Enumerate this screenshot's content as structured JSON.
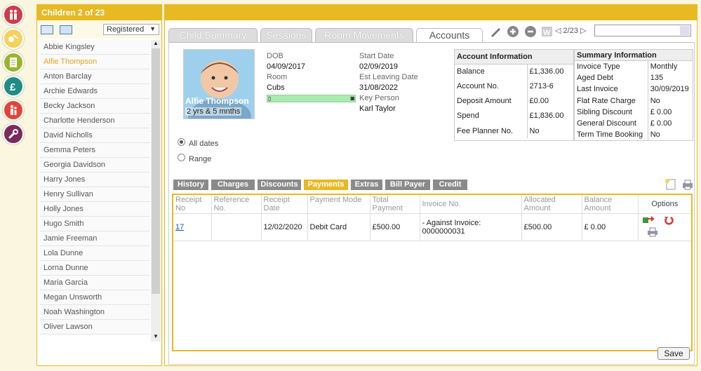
{
  "rail": [
    {
      "name": "children-nav-icon",
      "color": "#d03a4a"
    },
    {
      "name": "activities-nav-icon",
      "color": "#e8b923"
    },
    {
      "name": "registers-nav-icon",
      "color": "#9ab52d"
    },
    {
      "name": "finance-nav-icon",
      "color": "#1f8d84"
    },
    {
      "name": "staff-nav-icon",
      "color": "#e0453a"
    },
    {
      "name": "settings-nav-icon",
      "color": "#7b2a5b"
    }
  ],
  "children_panel": {
    "title": "Children 2 of 23",
    "filter_value": "Registered",
    "items": [
      "Abbie Kingsley",
      "Alfie Thompson",
      "Anton Barclay",
      "Archie Edwards",
      "Becky Jackson",
      "Charlotte Henderson",
      "David Nicholls",
      "Gemma Peters",
      "Georgia Davidson",
      "Harry Jones",
      "Henry Sullivan",
      "Holly Jones",
      "Hugo Smith",
      "Jamie Freeman",
      "Lola Dunne",
      "Lorna Dunne",
      "Maria Garcia",
      "Megan Unsworth",
      "Noah Washington",
      "Oliver Lawson"
    ],
    "active_index": 1
  },
  "tabs": [
    "Child Summary",
    "Sessions",
    "Room Movements",
    "Accounts"
  ],
  "active_tab": 3,
  "pager": "2/23",
  "search": {
    "value": "",
    "placeholder": ""
  },
  "child": {
    "name": "Alfie Thompson",
    "age": "2 yrs & 5 mnths",
    "dob_label": "DOB",
    "dob": "04/09/2017",
    "room_label": "Room",
    "room": "Cubs",
    "start_label": "Start Date",
    "start": "02/09/2019",
    "leave_label": "Est Leaving Date",
    "leave": "31/08/2022",
    "key_label": "Key Person",
    "key": "Karl Taylor"
  },
  "account_info": {
    "header": "Account Information",
    "rows": [
      [
        "Balance",
        "£1,336.00"
      ],
      [
        "Account No.",
        "2713-6"
      ],
      [
        "Deposit Amount",
        "£0.00"
      ],
      [
        "Spend",
        "£1,836.00"
      ],
      [
        "Fee Planner No.",
        "No"
      ]
    ]
  },
  "summary_info": {
    "header": "Summary Information",
    "rows": [
      [
        "Invoice Type",
        "Monthly"
      ],
      [
        "Aged Debt",
        "135"
      ],
      [
        "Last Invoice",
        "30/09/2019"
      ],
      [
        "Flat Rate Charge",
        "No"
      ],
      [
        "Sibling Discount",
        "£ 0.00"
      ],
      [
        "General Discount",
        "£ 0.00"
      ],
      [
        "Term Time Booking",
        "No"
      ]
    ]
  },
  "date_filter": {
    "all": "All dates",
    "range": "Range",
    "selected": "all"
  },
  "subtabs": [
    "History",
    "Charges",
    "Discounts",
    "Payments",
    "Extras",
    "Bill Payer",
    "Credit"
  ],
  "active_subtab": 3,
  "payments": {
    "headers": [
      "Receipt No",
      "Reference No.",
      "Receipt Date",
      "Payment Mode",
      "Total Payment",
      "Invoice No.",
      "Allocated Amount",
      "Balance Amount",
      "Options"
    ],
    "rows": [
      {
        "receipt": "17",
        "reference": "",
        "date": "12/02/2020",
        "mode": "Debit Card",
        "total": "£500.00",
        "invoice": "- Against Invoice: 0000000031",
        "allocated": "£500.00",
        "balance": "£ 0.00"
      }
    ]
  },
  "save_label": "Save"
}
